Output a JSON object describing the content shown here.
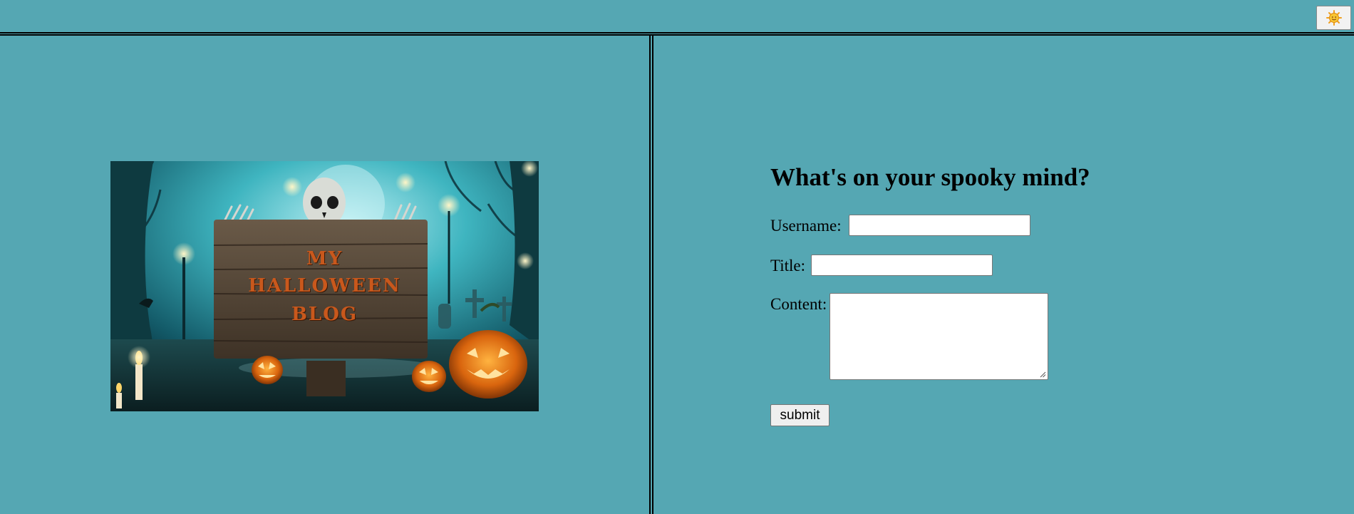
{
  "header": {
    "theme_toggle_icon": "sun-face-icon"
  },
  "banner": {
    "sign_lines": [
      "MY",
      "HALLOWEEN",
      "BLOG"
    ],
    "sign_color": "#c9581c"
  },
  "form": {
    "heading": "What's on your spooky mind?",
    "username_label": "Username:",
    "username_value": "",
    "title_label": "Title:",
    "title_value": "",
    "content_label": "Content:",
    "content_value": "",
    "submit_label": "submit"
  },
  "colors": {
    "background": "#55a7b3",
    "divider": "#000000"
  }
}
